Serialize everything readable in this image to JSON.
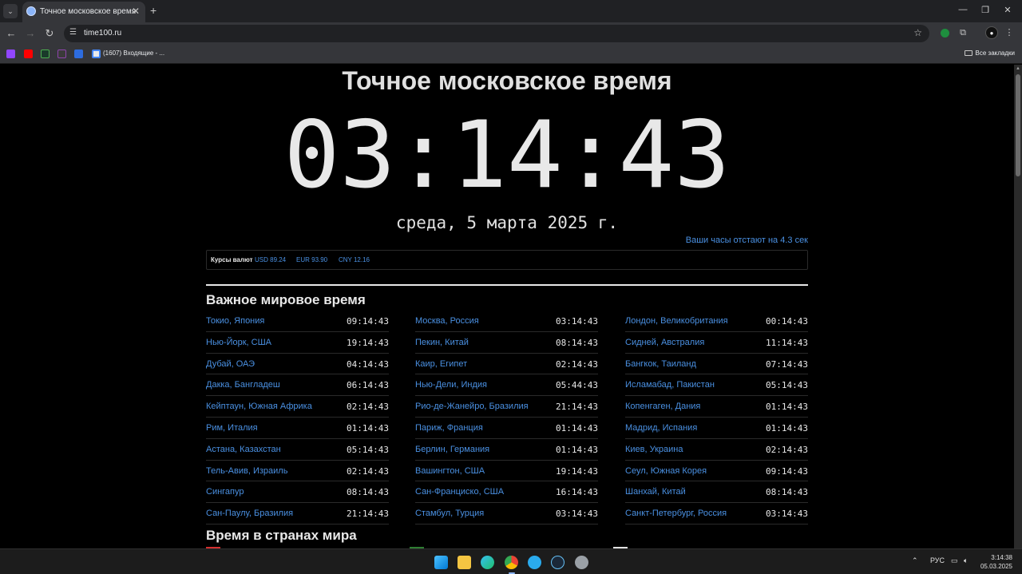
{
  "browser": {
    "tab_title": "Точное московское время",
    "url": "time100.ru",
    "bookmarks_text": "(1607) Входящие - ...",
    "all_bookmarks": "Все закладки"
  },
  "page": {
    "title": "Точное московское время",
    "clock": "03:14:43",
    "date": "среда, 5 марта 2025 г.",
    "offset_notice": "Ваши часы отстают на 4.3 сек"
  },
  "currency": {
    "label": "Курсы валют",
    "usd": "USD 89.24",
    "eur": "EUR 93.90",
    "cny": "CNY 12.16"
  },
  "world_time": {
    "title": "Важное мировое время",
    "col1": [
      {
        "city": "Токио, Япония",
        "time": "09:14:43"
      },
      {
        "city": "Нью-Йорк, США",
        "time": "19:14:43"
      },
      {
        "city": "Дубай, ОАЭ",
        "time": "04:14:43"
      },
      {
        "city": "Дакка, Бангладеш",
        "time": "06:14:43"
      },
      {
        "city": "Кейптаун, Южная Африка",
        "time": "02:14:43"
      },
      {
        "city": "Рим, Италия",
        "time": "01:14:43"
      },
      {
        "city": "Астана, Казахстан",
        "time": "05:14:43"
      },
      {
        "city": "Тель-Авив, Израиль",
        "time": "02:14:43"
      },
      {
        "city": "Сингапур",
        "time": "08:14:43"
      },
      {
        "city": "Сан-Паулу, Бразилия",
        "time": "21:14:43"
      }
    ],
    "col2": [
      {
        "city": "Москва, Россия",
        "time": "03:14:43"
      },
      {
        "city": "Пекин, Китай",
        "time": "08:14:43"
      },
      {
        "city": "Каир, Египет",
        "time": "02:14:43"
      },
      {
        "city": "Нью-Дели, Индия",
        "time": "05:44:43"
      },
      {
        "city": "Рио-де-Жанейро, Бразилия",
        "time": "21:14:43"
      },
      {
        "city": "Париж, Франция",
        "time": "01:14:43"
      },
      {
        "city": "Берлин, Германия",
        "time": "01:14:43"
      },
      {
        "city": "Вашингтон, США",
        "time": "19:14:43"
      },
      {
        "city": "Сан-Франциско, США",
        "time": "16:14:43"
      },
      {
        "city": "Стамбул, Турция",
        "time": "03:14:43"
      }
    ],
    "col3": [
      {
        "city": "Лондон, Великобритания",
        "time": "00:14:43"
      },
      {
        "city": "Сидней, Австралия",
        "time": "11:14:43"
      },
      {
        "city": "Бангкок, Таиланд",
        "time": "07:14:43"
      },
      {
        "city": "Исламабад, Пакистан",
        "time": "05:14:43"
      },
      {
        "city": "Копенгаген, Дания",
        "time": "01:14:43"
      },
      {
        "city": "Мадрид, Испания",
        "time": "01:14:43"
      },
      {
        "city": "Киев, Украина",
        "time": "02:14:43"
      },
      {
        "city": "Сеул, Южная Корея",
        "time": "09:14:43"
      },
      {
        "city": "Шанхай, Китай",
        "time": "08:14:43"
      },
      {
        "city": "Санкт-Петербург, Россия",
        "time": "03:14:43"
      }
    ]
  },
  "countries_title": "Время в странах мира",
  "taskbar": {
    "lang": "РУС",
    "time": "3:14:38",
    "date": "05.03.2025"
  },
  "colors": {
    "link": "#4a90e2",
    "background": "#000000",
    "chrome": "#35363a"
  }
}
